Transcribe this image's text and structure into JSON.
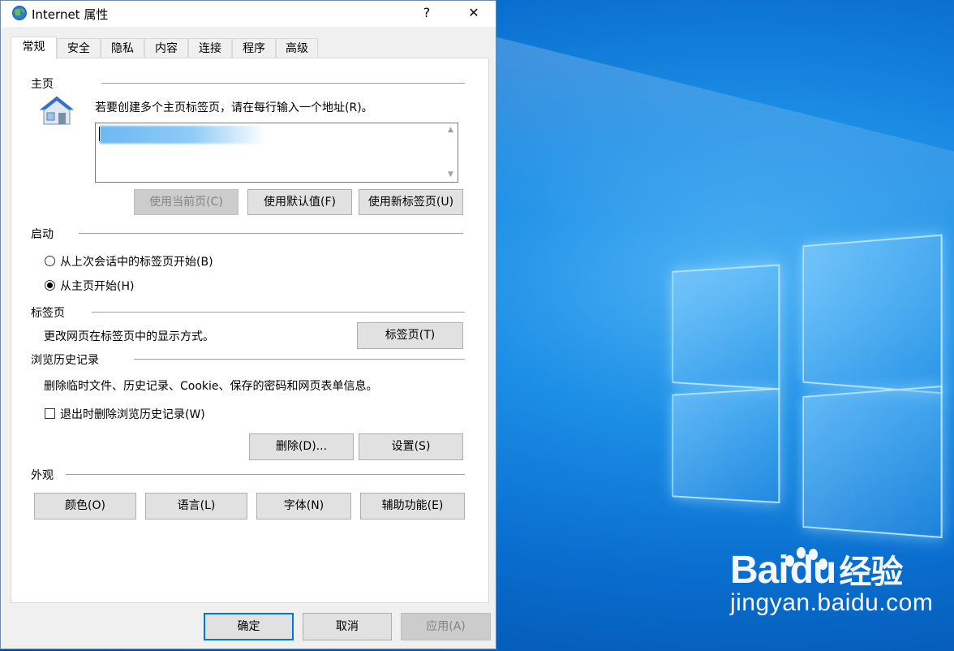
{
  "dialog": {
    "title": "Internet 属性",
    "help_glyph": "?",
    "close_glyph": "✕",
    "tabs": [
      "常规",
      "安全",
      "隐私",
      "内容",
      "连接",
      "程序",
      "高级"
    ],
    "active_tab": "常规"
  },
  "home": {
    "label": "主页",
    "hint": "若要创建多个主页标签页，请在每行输入一个地址(R)。",
    "icon": "house-icon",
    "buttons": [
      "使用当前页(C)",
      "使用默认值(F)",
      "使用新标签页(U)"
    ]
  },
  "startup": {
    "label": "启动",
    "options": [
      "从上次会话中的标签页开始(B)",
      "从主页开始(H)"
    ],
    "selected": "从主页开始(H)"
  },
  "tabs_section": {
    "label": "标签页",
    "description": "更改网页在标签页中的显示方式。",
    "button": "标签页(T)"
  },
  "history": {
    "label": "浏览历史记录",
    "description": "删除临时文件、历史记录、Cookie、保存的密码和网页表单信息。",
    "checkbox_label": "退出时删除浏览历史记录(W)",
    "checkbox_checked": false,
    "delete_button": "删除(D)...",
    "settings_button": "设置(S)"
  },
  "appearance": {
    "label": "外观",
    "buttons": [
      "颜色(O)",
      "语言(L)",
      "字体(N)",
      "辅助功能(E)"
    ]
  },
  "footer": {
    "ok": "确定",
    "cancel": "取消",
    "apply": "应用(A)"
  },
  "watermark": {
    "brand": "Bai",
    "brand_tail": "du",
    "suffix": "经验",
    "url": "jingyan.baidu.com"
  },
  "colors": {
    "accent": "#0078d7",
    "desktop": "#0a6fd0"
  }
}
